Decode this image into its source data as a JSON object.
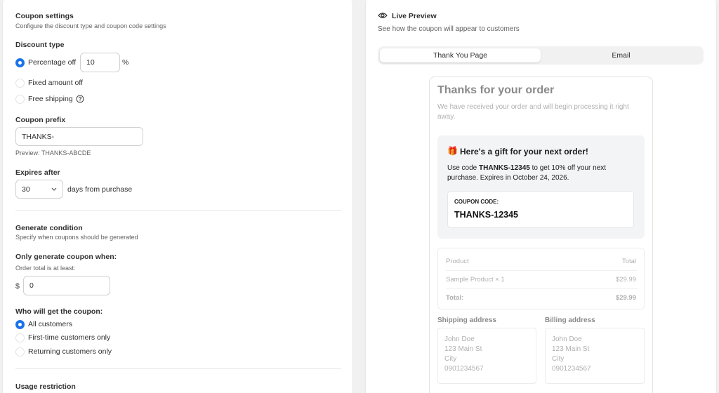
{
  "coupon_settings": {
    "title": "Coupon settings",
    "subtitle": "Configure the discount type and coupon code settings",
    "discount_type_label": "Discount type",
    "options": [
      {
        "label": "Percentage off",
        "selected": true
      },
      {
        "label": "Fixed amount off",
        "selected": false
      },
      {
        "label": "Free shipping",
        "selected": false
      }
    ],
    "percentage_value": "10",
    "percent_symbol": "%",
    "prefix_label": "Coupon prefix",
    "prefix_value": "THANKS-",
    "prefix_preview": "Preview: THANKS-ABCDE",
    "expires_label": "Expires after",
    "expires_value": "30",
    "expires_suffix": "days from purchase"
  },
  "generate_condition": {
    "title": "Generate condition",
    "subtitle": "Specify when coupons should be generated",
    "only_when_label": "Only generate coupon when:",
    "order_total_label": "Order total is at least:",
    "currency": "$",
    "order_total_value": "0",
    "who_label": "Who will get the coupon:",
    "audience_options": [
      {
        "label": "All customers",
        "selected": true
      },
      {
        "label": "First-time customers only",
        "selected": false
      },
      {
        "label": "Returning customers only",
        "selected": false
      }
    ]
  },
  "usage_restriction": {
    "title": "Usage restriction"
  },
  "preview": {
    "title": "Live Preview",
    "subtitle": "See how the coupon will appear to customers",
    "tabs": [
      {
        "label": "Thank You Page",
        "active": true
      },
      {
        "label": "Email",
        "active": false
      }
    ],
    "email": {
      "heading": "Thanks for your order",
      "intro_line1": "We have received your order and will begin processing it right",
      "intro_line2": "away.",
      "gift_emoji": "🎁",
      "gift_heading": "Here's a gift for your next order!",
      "body_prefix": "Use code ",
      "body_code": "THANKS-12345",
      "body_suffix": " to get 10% off your next",
      "body_line2": "purchase. Expires in October 24, 2026.",
      "coupon_code_label": "COUPON CODE:",
      "coupon_code": "THANKS-12345",
      "table": {
        "header_product": "Product",
        "header_total": "Total",
        "row_product": "Sample Product × 1",
        "row_total": "$29.99",
        "total_label": "Total:",
        "total_value": "$29.99"
      },
      "shipping_label": "Shipping address",
      "billing_label": "Billing address",
      "shipping": [
        "John Doe",
        "123 Main St",
        "City",
        "0901234567"
      ],
      "billing": [
        "John Doe",
        "123 Main St",
        "City",
        "0901234567"
      ]
    }
  },
  "colors": {
    "accent": "#1a73e8",
    "background": "#f1f1f1"
  },
  "icons": {
    "eye": "eye-icon",
    "help": "help-circle-icon",
    "chevron": "chevron-down-icon"
  }
}
